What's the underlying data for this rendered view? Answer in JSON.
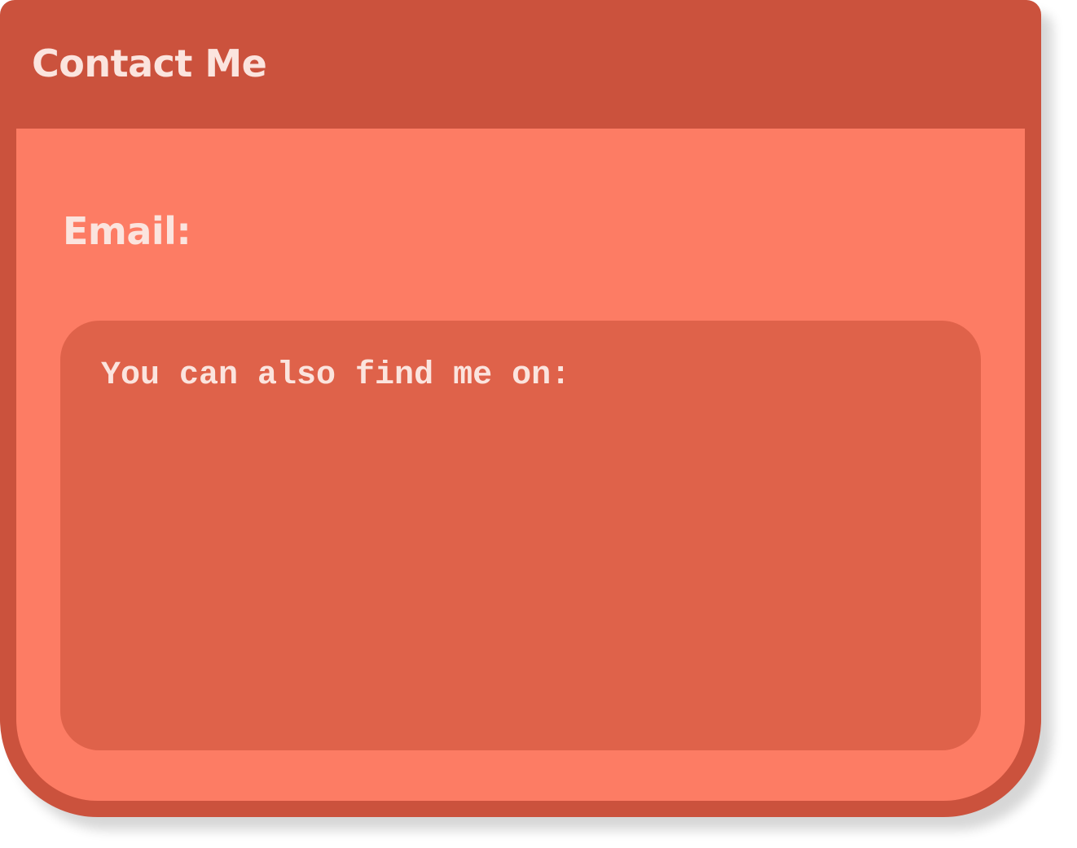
{
  "window": {
    "title": "Contact Me"
  },
  "contact": {
    "email_label": "Email:",
    "social_heading": "You can also find me on:"
  },
  "colors": {
    "frame": "#cb523d",
    "content_bg": "#fd7c64",
    "panel_bg": "#df624a",
    "text": "#fbe4de"
  }
}
